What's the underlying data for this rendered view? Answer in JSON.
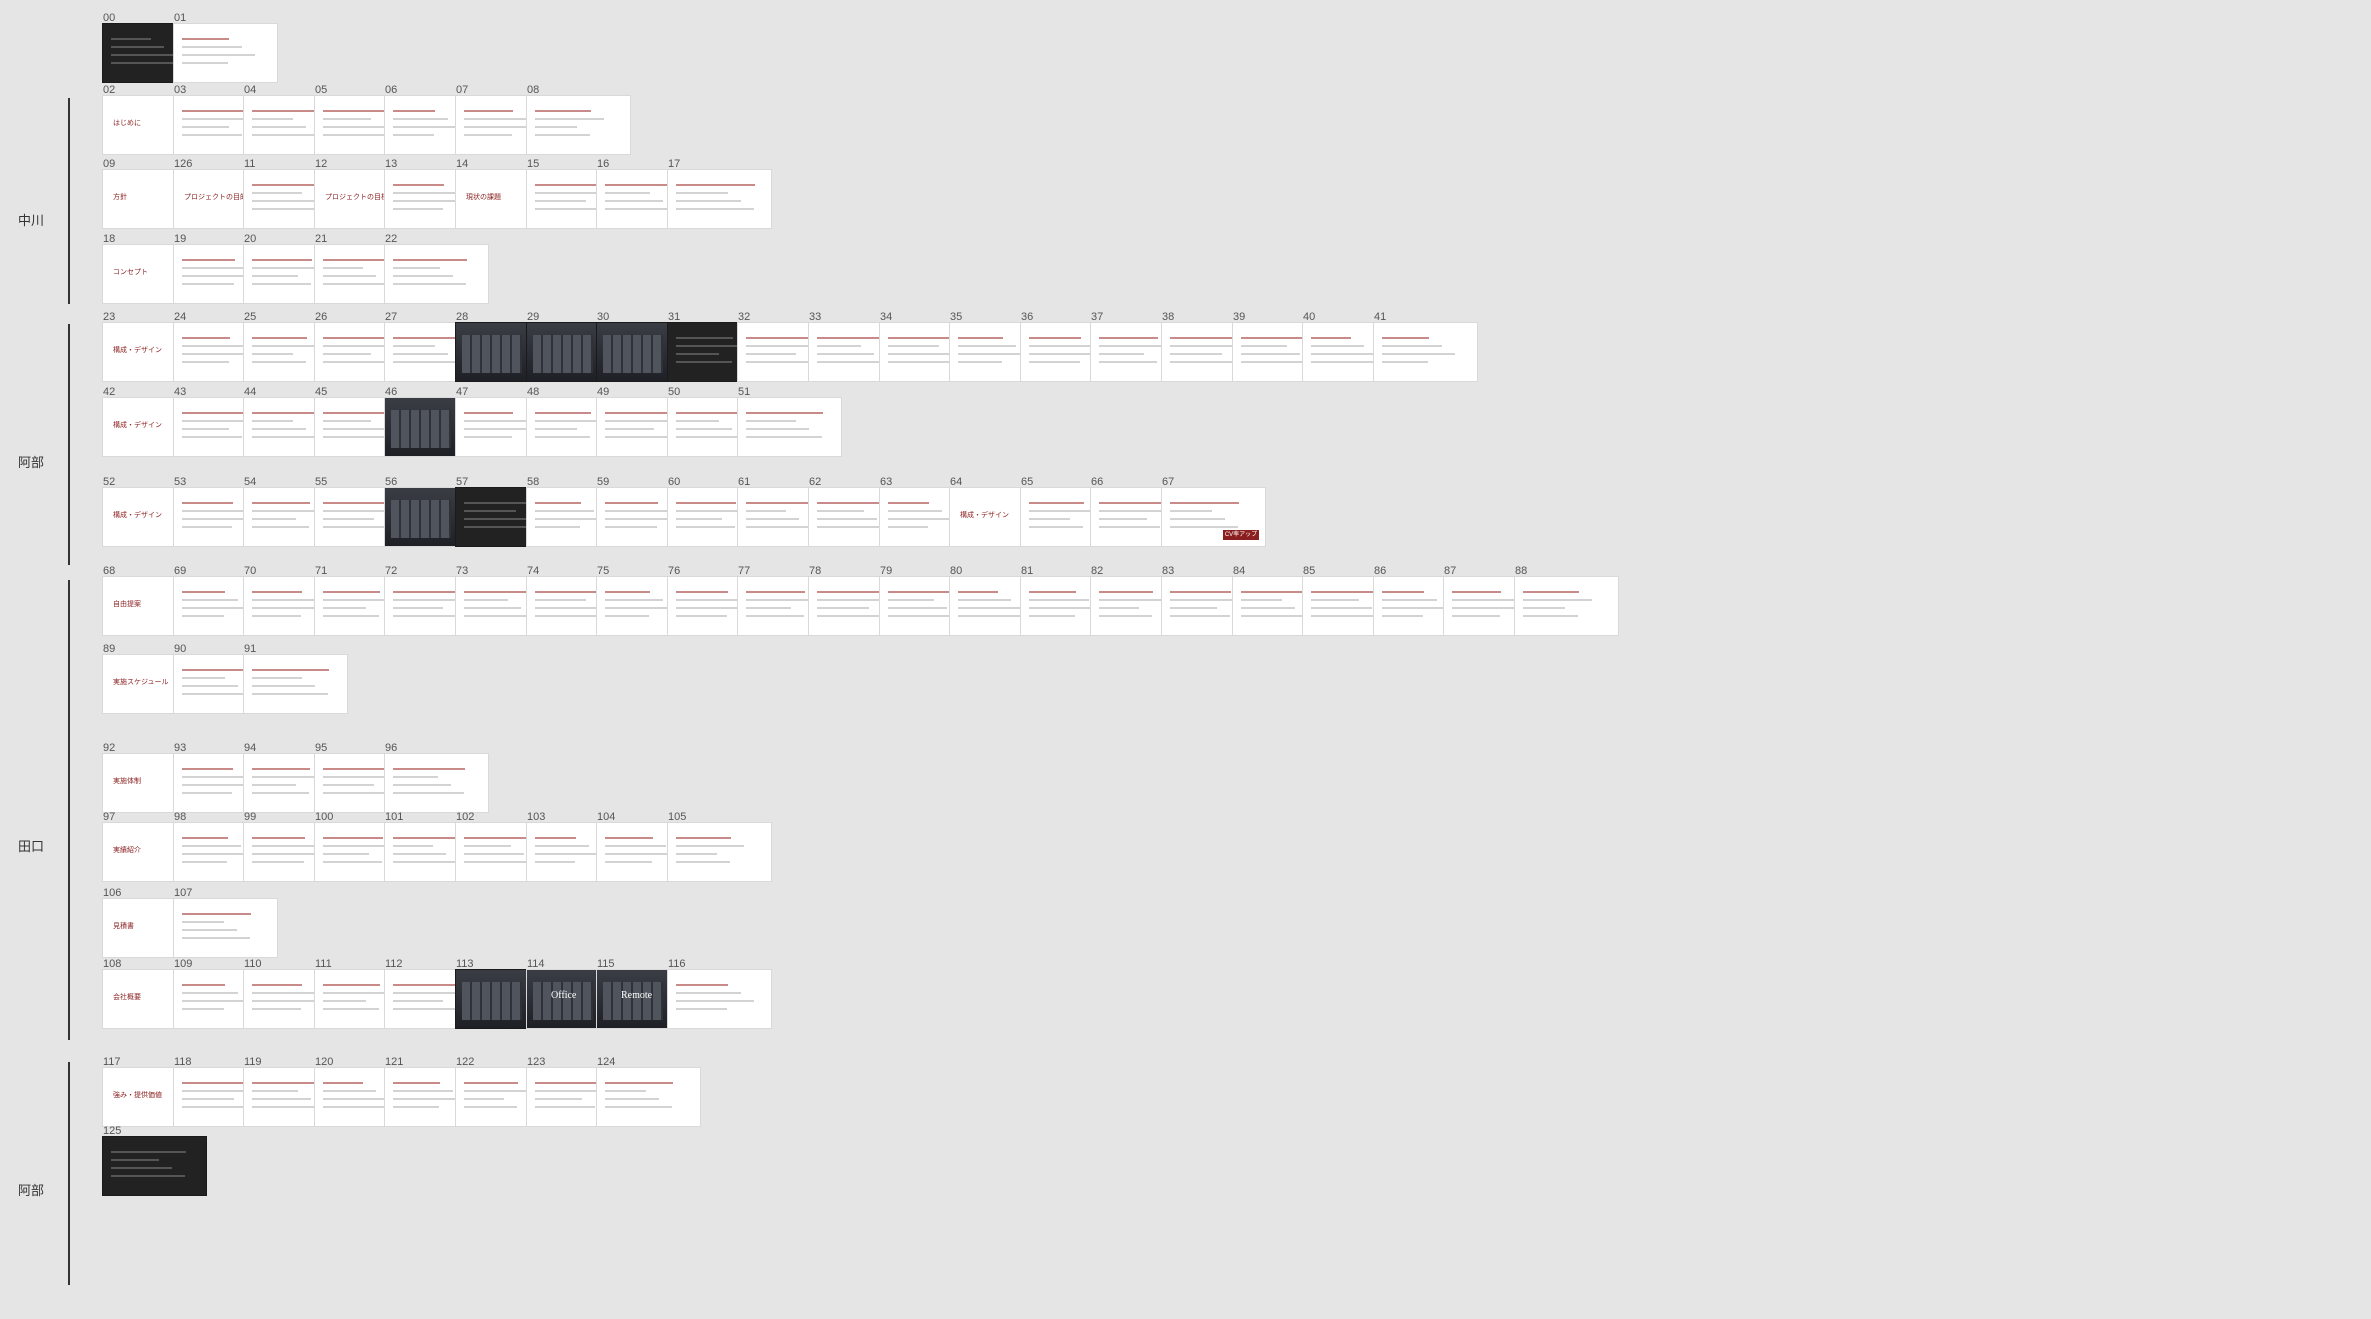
{
  "sections": [
    {
      "name": "中川"
    },
    {
      "name": "阿部"
    },
    {
      "name": "田口"
    },
    {
      "name": "阿部"
    }
  ],
  "slides": [
    {
      "num": "00",
      "title": "",
      "dark": true
    },
    {
      "num": "01",
      "title": ""
    },
    {
      "num": "02",
      "title": "はじめに"
    },
    {
      "num": "03",
      "title": ""
    },
    {
      "num": "04",
      "title": ""
    },
    {
      "num": "05",
      "title": ""
    },
    {
      "num": "06",
      "title": ""
    },
    {
      "num": "07",
      "title": ""
    },
    {
      "num": "08",
      "title": ""
    },
    {
      "num": "09",
      "title": "方針"
    },
    {
      "num": "126",
      "title": "プロジェクトの目的"
    },
    {
      "num": "11",
      "title": ""
    },
    {
      "num": "12",
      "title": "プロジェクトの目標"
    },
    {
      "num": "13",
      "title": ""
    },
    {
      "num": "14",
      "title": "現状の課題"
    },
    {
      "num": "15",
      "title": ""
    },
    {
      "num": "16",
      "title": ""
    },
    {
      "num": "17",
      "title": ""
    },
    {
      "num": "18",
      "title": "コンセプト"
    },
    {
      "num": "19",
      "title": ""
    },
    {
      "num": "20",
      "title": ""
    },
    {
      "num": "21",
      "title": ""
    },
    {
      "num": "22",
      "title": ""
    },
    {
      "num": "23",
      "title": "構成・デザイン"
    },
    {
      "num": "24",
      "title": ""
    },
    {
      "num": "25",
      "title": ""
    },
    {
      "num": "26",
      "title": ""
    },
    {
      "num": "27",
      "title": ""
    },
    {
      "num": "28",
      "title": "",
      "dark": true,
      "photo": true
    },
    {
      "num": "29",
      "title": "",
      "dark": true,
      "photo": true
    },
    {
      "num": "30",
      "title": "",
      "dark": true,
      "photo": true
    },
    {
      "num": "31",
      "title": "",
      "dark": true
    },
    {
      "num": "32",
      "title": ""
    },
    {
      "num": "33",
      "title": ""
    },
    {
      "num": "34",
      "title": ""
    },
    {
      "num": "35",
      "title": ""
    },
    {
      "num": "36",
      "title": ""
    },
    {
      "num": "37",
      "title": ""
    },
    {
      "num": "38",
      "title": ""
    },
    {
      "num": "39",
      "title": ""
    },
    {
      "num": "40",
      "title": ""
    },
    {
      "num": "41",
      "title": ""
    },
    {
      "num": "42",
      "title": "構成・デザイン"
    },
    {
      "num": "43",
      "title": ""
    },
    {
      "num": "44",
      "title": ""
    },
    {
      "num": "45",
      "title": ""
    },
    {
      "num": "46",
      "title": "",
      "photo": true
    },
    {
      "num": "47",
      "title": ""
    },
    {
      "num": "48",
      "title": ""
    },
    {
      "num": "49",
      "title": ""
    },
    {
      "num": "50",
      "title": ""
    },
    {
      "num": "51",
      "title": ""
    },
    {
      "num": "52",
      "title": "構成・デザイン"
    },
    {
      "num": "53",
      "title": ""
    },
    {
      "num": "54",
      "title": ""
    },
    {
      "num": "55",
      "title": ""
    },
    {
      "num": "56",
      "title": "",
      "photo": true
    },
    {
      "num": "57",
      "title": "",
      "dark": true
    },
    {
      "num": "58",
      "title": ""
    },
    {
      "num": "59",
      "title": ""
    },
    {
      "num": "60",
      "title": ""
    },
    {
      "num": "61",
      "title": ""
    },
    {
      "num": "62",
      "title": ""
    },
    {
      "num": "63",
      "title": ""
    },
    {
      "num": "64",
      "title": "構成・デザイン"
    },
    {
      "num": "65",
      "title": ""
    },
    {
      "num": "66",
      "title": ""
    },
    {
      "num": "67",
      "title": "",
      "cta": "CV率アップ"
    },
    {
      "num": "68",
      "title": "自由提案"
    },
    {
      "num": "69",
      "title": ""
    },
    {
      "num": "70",
      "title": ""
    },
    {
      "num": "71",
      "title": ""
    },
    {
      "num": "72",
      "title": ""
    },
    {
      "num": "73",
      "title": ""
    },
    {
      "num": "74",
      "title": ""
    },
    {
      "num": "75",
      "title": ""
    },
    {
      "num": "76",
      "title": ""
    },
    {
      "num": "77",
      "title": ""
    },
    {
      "num": "78",
      "title": ""
    },
    {
      "num": "79",
      "title": ""
    },
    {
      "num": "80",
      "title": ""
    },
    {
      "num": "81",
      "title": ""
    },
    {
      "num": "82",
      "title": ""
    },
    {
      "num": "83",
      "title": ""
    },
    {
      "num": "84",
      "title": ""
    },
    {
      "num": "85",
      "title": ""
    },
    {
      "num": "86",
      "title": ""
    },
    {
      "num": "87",
      "title": ""
    },
    {
      "num": "88",
      "title": ""
    },
    {
      "num": "89",
      "title": "実施スケジュール"
    },
    {
      "num": "90",
      "title": ""
    },
    {
      "num": "91",
      "title": ""
    },
    {
      "num": "92",
      "title": "実施体制"
    },
    {
      "num": "93",
      "title": ""
    },
    {
      "num": "94",
      "title": ""
    },
    {
      "num": "95",
      "title": ""
    },
    {
      "num": "96",
      "title": ""
    },
    {
      "num": "97",
      "title": "実績紹介"
    },
    {
      "num": "98",
      "title": ""
    },
    {
      "num": "99",
      "title": ""
    },
    {
      "num": "100",
      "title": ""
    },
    {
      "num": "101",
      "title": ""
    },
    {
      "num": "102",
      "title": ""
    },
    {
      "num": "103",
      "title": ""
    },
    {
      "num": "104",
      "title": ""
    },
    {
      "num": "105",
      "title": ""
    },
    {
      "num": "106",
      "title": "見積書"
    },
    {
      "num": "107",
      "title": ""
    },
    {
      "num": "108",
      "title": "会社概要"
    },
    {
      "num": "109",
      "title": ""
    },
    {
      "num": "110",
      "title": ""
    },
    {
      "num": "111",
      "title": ""
    },
    {
      "num": "112",
      "title": ""
    },
    {
      "num": "113",
      "title": "",
      "dark": true,
      "photo": true
    },
    {
      "num": "114",
      "title": "Office",
      "photo": true
    },
    {
      "num": "115",
      "title": "Remote",
      "photo": true
    },
    {
      "num": "116",
      "title": ""
    },
    {
      "num": "117",
      "title": "強み・提供価値"
    },
    {
      "num": "118",
      "title": ""
    },
    {
      "num": "119",
      "title": ""
    },
    {
      "num": "120",
      "title": ""
    },
    {
      "num": "121",
      "title": ""
    },
    {
      "num": "122",
      "title": ""
    },
    {
      "num": "123",
      "title": ""
    },
    {
      "num": "124",
      "title": ""
    },
    {
      "num": "125",
      "title": "",
      "dark": true
    }
  ]
}
